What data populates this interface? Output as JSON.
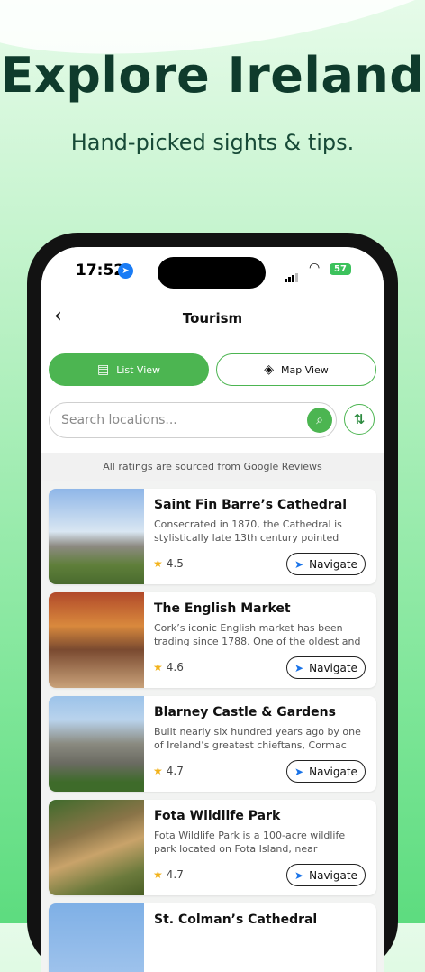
{
  "hero": {
    "title": "Explore Ireland",
    "subtitle": "Hand-picked sights & tips."
  },
  "status": {
    "time": "17:52",
    "battery": "57"
  },
  "nav": {
    "title": "Tourism",
    "back_icon": "chevron-left-icon"
  },
  "toggle": {
    "list_label": "List View",
    "map_label": "Map View"
  },
  "search": {
    "placeholder": "Search locations..."
  },
  "notice": "All ratings are sourced from Google Reviews",
  "navigate_label": "Navigate",
  "places": [
    {
      "name": "Saint Fin Barre’s Cathedral",
      "desc": "Consecrated in 1870, the Cathedral is stylistically late 13th century pointed",
      "rating": "4.5"
    },
    {
      "name": "The English Market",
      "desc": "Cork’s iconic English market has been trading since 1788. One of the oldest and",
      "rating": "4.6"
    },
    {
      "name": "Blarney Castle & Gardens",
      "desc": "Built nearly six hundred years ago by one of Ireland’s greatest chieftans, Cormac",
      "rating": "4.7"
    },
    {
      "name": "Fota Wildlife Park",
      "desc": "Fota Wildlife Park is a 100-acre wildlife park located on Fota Island, near",
      "rating": "4.7"
    },
    {
      "name": "St. Colman’s Cathedral",
      "desc": "",
      "rating": ""
    }
  ]
}
